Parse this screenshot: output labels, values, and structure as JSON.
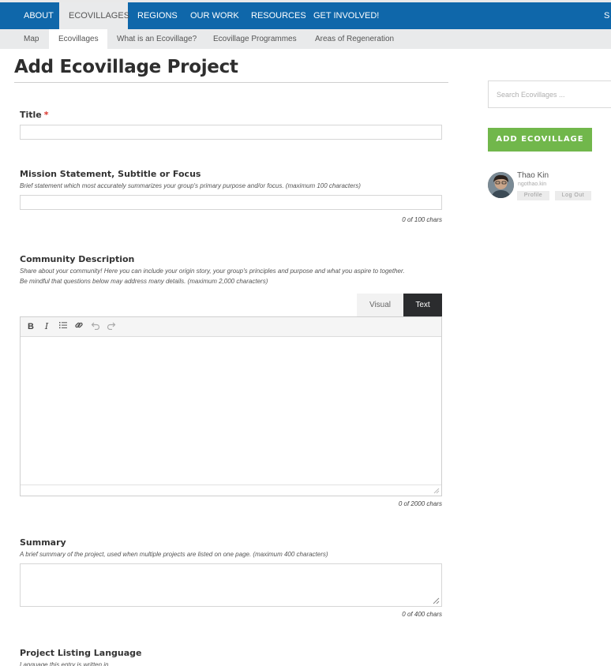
{
  "top_nav": {
    "items": [
      {
        "label": "ABOUT",
        "active": false
      },
      {
        "label": "ECOVILLAGES",
        "active": true
      },
      {
        "label": "REGIONS",
        "active": false
      },
      {
        "label": "OUR WORK",
        "active": false
      },
      {
        "label": "RESOURCES",
        "active": false
      },
      {
        "label": "GET INVOLVED!",
        "active": false
      }
    ],
    "edge_label": "S",
    "color": "#0f67aa"
  },
  "sub_nav": {
    "items": [
      {
        "label": "Map",
        "active": false
      },
      {
        "label": "Ecovillages",
        "active": true
      },
      {
        "label": "What is an Ecovillage?",
        "active": false
      },
      {
        "label": "Ecovillage Programmes",
        "active": false
      },
      {
        "label": "Areas of Regeneration",
        "active": false
      }
    ]
  },
  "page": {
    "title": "Add Ecovillage Project"
  },
  "form": {
    "title_field": {
      "label": "Title",
      "required_mark": "*",
      "value": ""
    },
    "mission": {
      "label": "Mission Statement, Subtitle or Focus",
      "help": "Brief statement which most accurately summarizes your group's primary purpose and/or focus. (maximum 100 characters)",
      "value": "",
      "counter": "0 of 100 chars"
    },
    "description": {
      "label": "Community Description",
      "help_line1": "Share about your community! Here you can include your origin story, your group's principles and purpose and what you aspire to together.",
      "help_line2": "Be mindful that questions below may address many details. (maximum 2,000 characters)",
      "tab_visual": "Visual",
      "tab_text": "Text",
      "active_tab": "Text",
      "toolbar": {
        "bold": "B",
        "italic": "I"
      },
      "counter": "0 of 2000 chars"
    },
    "summary": {
      "label": "Summary",
      "help": "A brief summary of the project, used when multiple projects are listed on one page. (maximum 400 characters)",
      "value": "",
      "counter": "0 of 400 chars"
    },
    "language": {
      "label": "Project Listing Language",
      "help": "Language this entry is written in"
    }
  },
  "sidebar": {
    "search_placeholder": "Search Ecovillages ...",
    "add_button": "ADD ECOVILLAGE",
    "add_button_color": "#71b74b",
    "user": {
      "name": "Thao Kin",
      "handle": "ngothao.kin",
      "profile_button": "Profile",
      "logout_button": "Log Out"
    }
  }
}
